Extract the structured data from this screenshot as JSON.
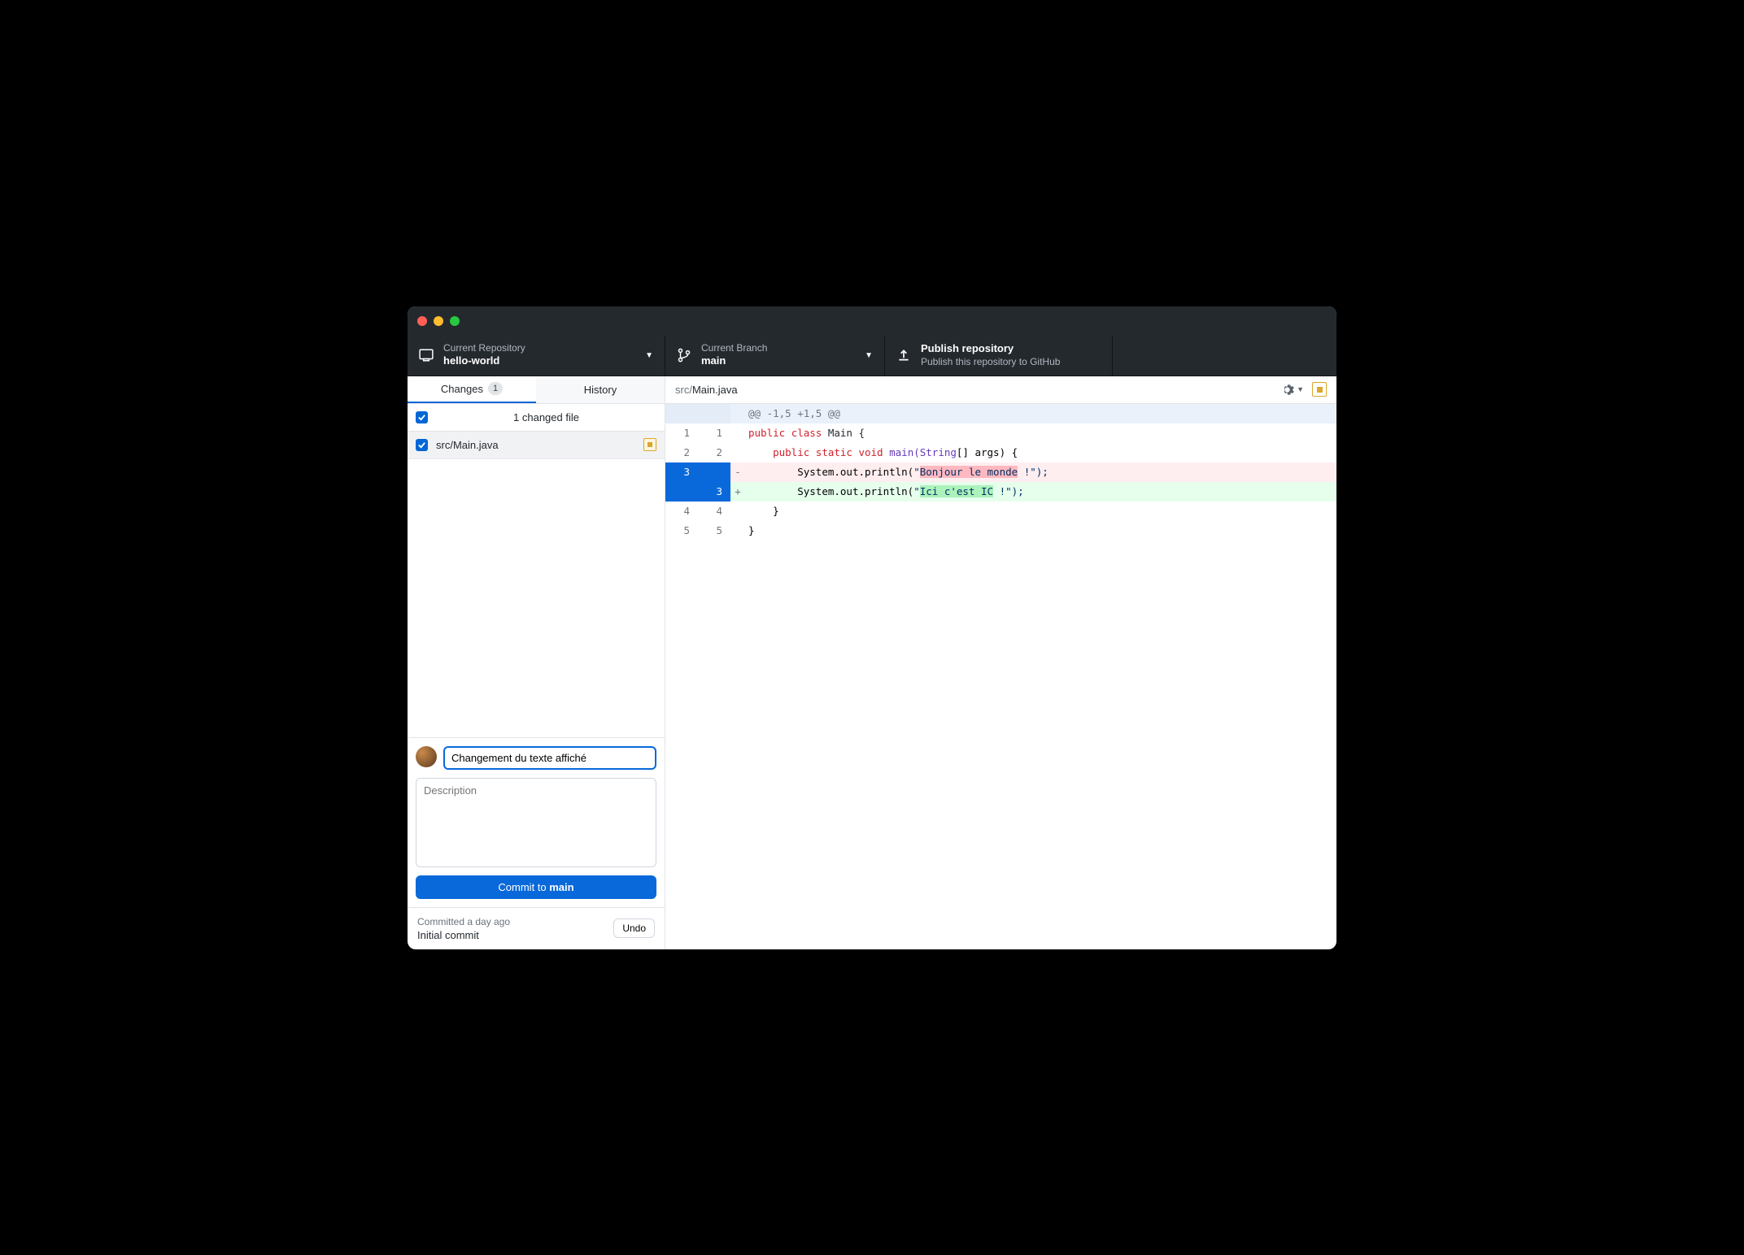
{
  "toolbar": {
    "repo": {
      "label": "Current Repository",
      "value": "hello-world"
    },
    "branch": {
      "label": "Current Branch",
      "value": "main"
    },
    "publish": {
      "title": "Publish repository",
      "subtitle": "Publish this repository to GitHub"
    }
  },
  "tabs": {
    "changes": {
      "label": "Changes",
      "count": "1"
    },
    "history": {
      "label": "History"
    }
  },
  "changes": {
    "header": "1 changed file",
    "files": [
      {
        "path": "src/Main.java"
      }
    ]
  },
  "commit_form": {
    "summary_value": "Changement du texte affiché",
    "description_placeholder": "Description",
    "button_prefix": "Commit to ",
    "button_branch": "main"
  },
  "last_commit": {
    "time": "Committed a day ago",
    "message": "Initial commit",
    "undo_label": "Undo"
  },
  "diff": {
    "path_prefix": "src/",
    "path_name": "Main.java",
    "hunk": "@@ -1,5 +1,5 @@",
    "lines": {
      "l1": {
        "old": "1",
        "new": "1",
        "kw1": "public",
        "kw2": "class",
        "name": " Main {"
      },
      "l2": {
        "old": "2",
        "new": "2",
        "indent": "    ",
        "kw1": "public",
        "kw2": "static",
        "kw3": "void",
        "fn": " main(",
        "type": "String",
        "rest": "[] args) {"
      },
      "l3": {
        "old": "3",
        "indent": "        ",
        "call": "System.out.println(",
        "q1": "\"",
        "hl": "Bonjour le monde",
        "tail": " !\");"
      },
      "l4": {
        "new": "3",
        "indent": "        ",
        "call": "System.out.println(",
        "q1": "\"",
        "hl": "Ici c'est IC",
        "tail": " !\");"
      },
      "l5": {
        "old": "4",
        "new": "4",
        "text": "    }"
      },
      "l6": {
        "old": "5",
        "new": "5",
        "text": "}"
      }
    }
  }
}
